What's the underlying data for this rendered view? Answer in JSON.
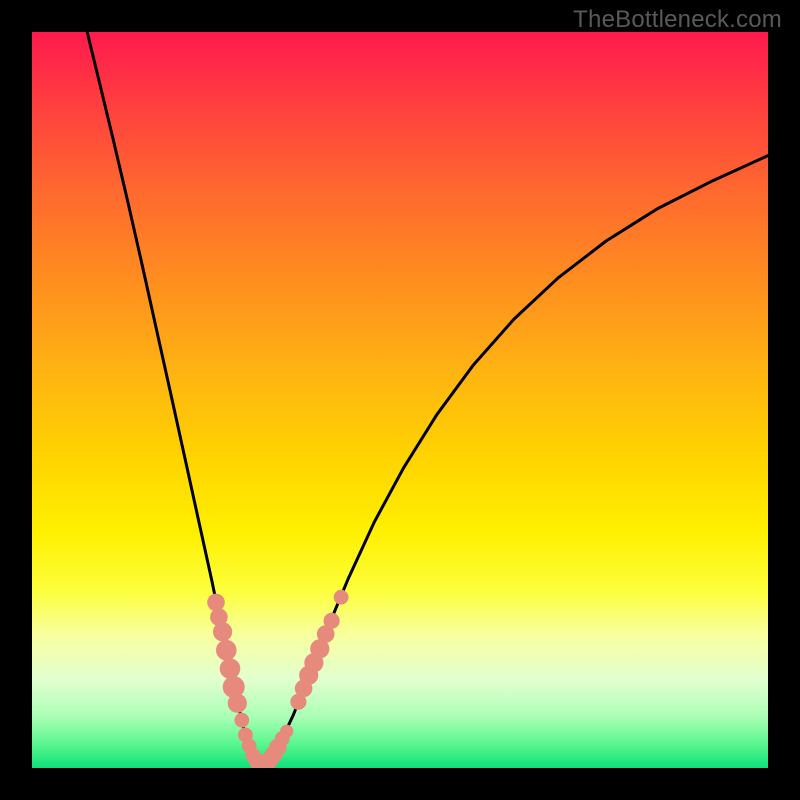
{
  "watermark": "TheBottleneck.com",
  "chart_data": {
    "type": "line",
    "title": "",
    "xlabel": "",
    "ylabel": "",
    "xlim": [
      0,
      100
    ],
    "ylim": [
      0,
      100
    ],
    "grid": false,
    "legend": false,
    "curves": {
      "left": [
        {
          "x": 7.5,
          "y": 100.0
        },
        {
          "x": 9.2,
          "y": 93.0
        },
        {
          "x": 11.0,
          "y": 85.5
        },
        {
          "x": 13.0,
          "y": 77.0
        },
        {
          "x": 15.0,
          "y": 68.2
        },
        {
          "x": 17.0,
          "y": 59.2
        },
        {
          "x": 19.0,
          "y": 50.2
        },
        {
          "x": 20.8,
          "y": 42.0
        },
        {
          "x": 22.6,
          "y": 33.8
        },
        {
          "x": 24.4,
          "y": 25.6
        },
        {
          "x": 25.6,
          "y": 19.8
        },
        {
          "x": 26.8,
          "y": 14.0
        },
        {
          "x": 27.8,
          "y": 9.4
        },
        {
          "x": 28.8,
          "y": 5.2
        },
        {
          "x": 29.8,
          "y": 2.2
        },
        {
          "x": 30.9,
          "y": 0.5
        }
      ],
      "right": [
        {
          "x": 30.9,
          "y": 0.5
        },
        {
          "x": 32.2,
          "y": 1.3
        },
        {
          "x": 33.8,
          "y": 3.6
        },
        {
          "x": 35.5,
          "y": 7.2
        },
        {
          "x": 37.5,
          "y": 12.2
        },
        {
          "x": 40.0,
          "y": 18.6
        },
        {
          "x": 43.0,
          "y": 25.8
        },
        {
          "x": 46.5,
          "y": 33.4
        },
        {
          "x": 50.5,
          "y": 40.8
        },
        {
          "x": 55.0,
          "y": 48.0
        },
        {
          "x": 60.0,
          "y": 54.8
        },
        {
          "x": 65.5,
          "y": 61.0
        },
        {
          "x": 71.5,
          "y": 66.6
        },
        {
          "x": 78.0,
          "y": 71.6
        },
        {
          "x": 85.0,
          "y": 76.0
        },
        {
          "x": 92.5,
          "y": 79.8
        },
        {
          "x": 100.0,
          "y": 83.2
        }
      ]
    },
    "series": [
      {
        "name": "dots",
        "type": "scatter",
        "color": "#e78a7e",
        "points": [
          {
            "x": 25.0,
            "y": 22.5,
            "r": 1.2
          },
          {
            "x": 25.4,
            "y": 20.5,
            "r": 1.2
          },
          {
            "x": 25.9,
            "y": 18.5,
            "r": 1.3
          },
          {
            "x": 26.4,
            "y": 16.0,
            "r": 1.4
          },
          {
            "x": 26.9,
            "y": 13.5,
            "r": 1.4
          },
          {
            "x": 27.4,
            "y": 11.0,
            "r": 1.5
          },
          {
            "x": 27.9,
            "y": 8.8,
            "r": 1.3
          },
          {
            "x": 28.5,
            "y": 6.5,
            "r": 1.0
          },
          {
            "x": 29.0,
            "y": 4.5,
            "r": 1.0
          },
          {
            "x": 29.5,
            "y": 3.0,
            "r": 1.0
          },
          {
            "x": 30.0,
            "y": 1.8,
            "r": 1.0
          },
          {
            "x": 30.5,
            "y": 1.0,
            "r": 1.1
          },
          {
            "x": 31.0,
            "y": 0.5,
            "r": 1.2
          },
          {
            "x": 31.6,
            "y": 0.5,
            "r": 1.2
          },
          {
            "x": 32.2,
            "y": 1.0,
            "r": 1.2
          },
          {
            "x": 32.8,
            "y": 1.8,
            "r": 1.2
          },
          {
            "x": 33.4,
            "y": 2.8,
            "r": 1.2
          },
          {
            "x": 34.0,
            "y": 4.0,
            "r": 1.0
          },
          {
            "x": 34.6,
            "y": 5.0,
            "r": 0.9
          },
          {
            "x": 36.2,
            "y": 9.0,
            "r": 1.1
          },
          {
            "x": 36.9,
            "y": 10.8,
            "r": 1.2
          },
          {
            "x": 37.6,
            "y": 12.6,
            "r": 1.3
          },
          {
            "x": 38.3,
            "y": 14.3,
            "r": 1.3
          },
          {
            "x": 39.1,
            "y": 16.2,
            "r": 1.3
          },
          {
            "x": 39.9,
            "y": 18.2,
            "r": 1.2
          },
          {
            "x": 40.7,
            "y": 20.0,
            "r": 1.1
          },
          {
            "x": 42.0,
            "y": 23.2,
            "r": 1.0
          }
        ]
      }
    ]
  }
}
